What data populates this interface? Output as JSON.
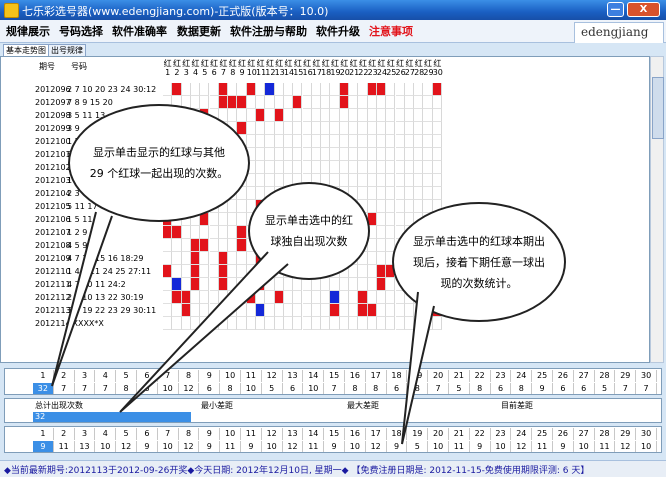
{
  "window": {
    "title": "七乐彩选号器(www.edengjiang.com)-正式版(版本号：10.0)",
    "min_label": "—",
    "close_label": "X"
  },
  "menu": [
    "规律展示",
    "号码选择",
    "软件准确率",
    "数据更新",
    "软件注册与帮助",
    "软件升级",
    "注意事项"
  ],
  "logo": "edengjiang",
  "tabs": [
    "基本走势图",
    "出号规律"
  ],
  "grid": {
    "header_period": "期号",
    "header_numbers": "号码",
    "header_red": "红",
    "ball_numbers": [
      "1",
      "2",
      "3",
      "4",
      "5",
      "6",
      "7",
      "8",
      "9",
      "10",
      "11",
      "12",
      "13",
      "14",
      "15",
      "16",
      "17",
      "18",
      "19",
      "20",
      "21",
      "22",
      "23",
      "24",
      "25",
      "26",
      "27",
      "28",
      "29",
      "30"
    ],
    "rows": [
      {
        "period": "2012096",
        "numbers": "2 7 10 20 23 24 30:12"
      },
      {
        "period": "2012097",
        "numbers": "7 8 9 15 20"
      },
      {
        "period": "2012098",
        "numbers": "3 5 11 13"
      },
      {
        "period": "2012099",
        "numbers": "3 9"
      },
      {
        "period": "2012100",
        "numbers": "1 5"
      },
      {
        "period": "2012101",
        "numbers": "6 8"
      },
      {
        "period": "2012102",
        "numbers": "2 4"
      },
      {
        "period": "2012103",
        "numbers": "1 3"
      },
      {
        "period": "2012104",
        "numbers": "2 3"
      },
      {
        "period": "2012105",
        "numbers": "5 11 17"
      },
      {
        "period": "2012106",
        "numbers": "1 5 11 23"
      },
      {
        "period": "2012107",
        "numbers": "1 2 9 15"
      },
      {
        "period": "2012108",
        "numbers": "4 5 9 15"
      },
      {
        "period": "2012109",
        "numbers": "4 7 11 15 16 18:29"
      },
      {
        "period": "2012110",
        "numbers": "1 4 7 11 24 25 27:11"
      },
      {
        "period": "2012111",
        "numbers": "4 7 10 11 24:2"
      },
      {
        "period": "2012112",
        "numbers": "2 3 10 13 22 30:19"
      },
      {
        "period": "2012113",
        "numbers": "3 7 19 22 23 29 30:11"
      },
      {
        "period": "2012114",
        "numbers": "XXXXX*X"
      }
    ]
  },
  "panel1": {
    "numbers": [
      "1",
      "2",
      "3",
      "4",
      "5",
      "6",
      "7",
      "8",
      "9",
      "10",
      "11",
      "12",
      "13",
      "14",
      "15",
      "16",
      "17",
      "18",
      "19",
      "20",
      "21",
      "22",
      "23",
      "24",
      "25",
      "26",
      "27",
      "28",
      "29",
      "30"
    ],
    "values": [
      "32",
      "7",
      "7",
      "7",
      "8",
      "6",
      "10",
      "12",
      "6",
      "8",
      "10",
      "5",
      "6",
      "10",
      "7",
      "8",
      "8",
      "6",
      "8",
      "7",
      "5",
      "8",
      "6",
      "8",
      "9",
      "6",
      "6",
      "5",
      "7",
      "7"
    ]
  },
  "panel2": {
    "col_total": "总计出现次数",
    "col_min": "最小差距",
    "col_max": "最大差距",
    "col_current": "目前差距",
    "total_value": "32"
  },
  "panel3": {
    "numbers": [
      "1",
      "2",
      "3",
      "4",
      "5",
      "6",
      "7",
      "8",
      "9",
      "10",
      "11",
      "12",
      "13",
      "14",
      "15",
      "16",
      "17",
      "18",
      "19",
      "20",
      "21",
      "22",
      "23",
      "24",
      "25",
      "26",
      "27",
      "28",
      "29",
      "30"
    ],
    "values": [
      "9",
      "11",
      "13",
      "10",
      "12",
      "9",
      "10",
      "12",
      "9",
      "11",
      "9",
      "10",
      "12",
      "11",
      "9",
      "10",
      "12",
      "9",
      "5",
      "10",
      "11",
      "9",
      "10",
      "12",
      "11",
      "9",
      "10",
      "11",
      "12",
      "10"
    ]
  },
  "status": "◆当前最新期号:2012113于2012-09-26开奖◆今天日期: 2012年12月10日, 星期一◆  【免费注册日期是: 2012-11-15-免费使用期限评测: 6 天】",
  "bubbles": {
    "b1": "显示单击显示的红球与其他 29 个红球一起出现的次数。",
    "b2": "显示单击选中的红球独自出现次数",
    "b3": "显示单击选中的红球本期出现后，接着下期任意一球出现的次数统计。"
  },
  "colors": {
    "red": "#e2141b",
    "blue": "#1428d8",
    "title": "#1a5fc2"
  }
}
